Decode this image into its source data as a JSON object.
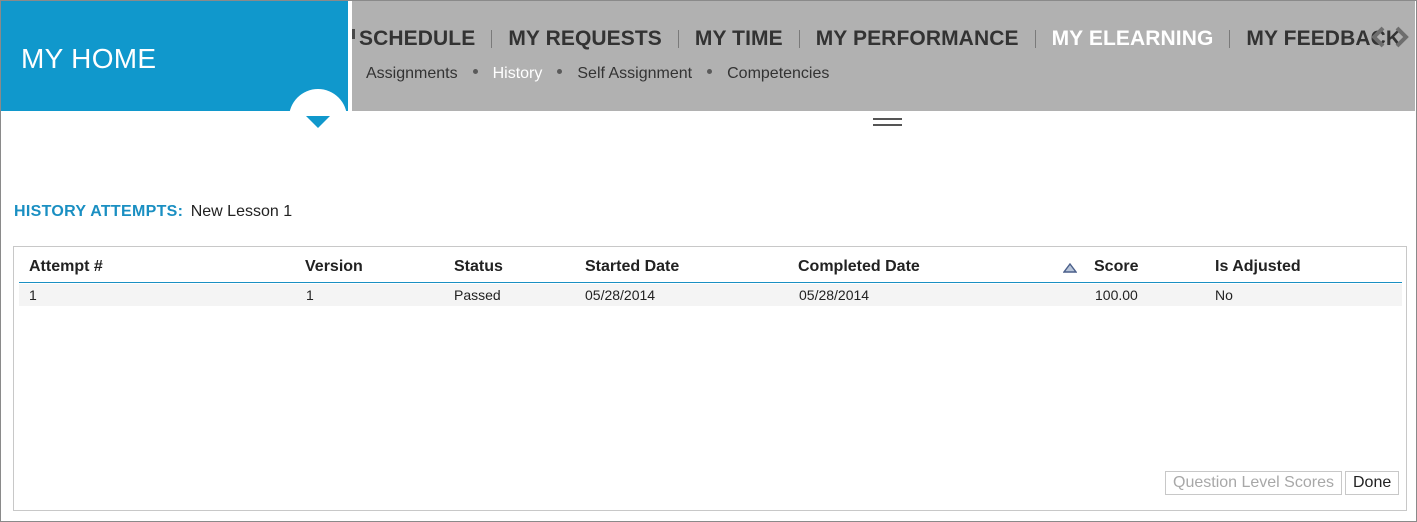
{
  "home": {
    "title": "MY HOME"
  },
  "nav": {
    "items": [
      {
        "label": "SCHEDULE"
      },
      {
        "label": "MY REQUESTS"
      },
      {
        "label": "MY TIME"
      },
      {
        "label": "MY PERFORMANCE"
      },
      {
        "label": "MY ELEARNING"
      },
      {
        "label": "MY FEEDBACK"
      }
    ],
    "active": "MY ELEARNING"
  },
  "subnav": {
    "items": [
      {
        "label": "Assignments"
      },
      {
        "label": "History"
      },
      {
        "label": "Self Assignment"
      },
      {
        "label": "Competencies"
      }
    ],
    "active": "History"
  },
  "heading": {
    "label": "HISTORY ATTEMPTS:",
    "value": "New Lesson 1"
  },
  "table": {
    "columns": [
      "Attempt #",
      "Version",
      "Status",
      "Started Date",
      "Completed Date",
      "Score",
      "Is Adjusted"
    ],
    "rows": [
      [
        "1",
        "1",
        "Passed",
        "05/28/2014",
        "05/28/2014",
        "100.00",
        "No"
      ]
    ]
  },
  "buttons": {
    "question_level_scores": "Question Level Scores",
    "done": "Done"
  },
  "colors": {
    "accent": "#1098cc",
    "nav_bg": "#b1b1b1",
    "active_text": "#ffffff"
  },
  "icons": [
    "chevron-down-icon",
    "chevron-left-icon",
    "chevron-right-icon",
    "drag-handle-icon",
    "sort-ascending-icon"
  ]
}
